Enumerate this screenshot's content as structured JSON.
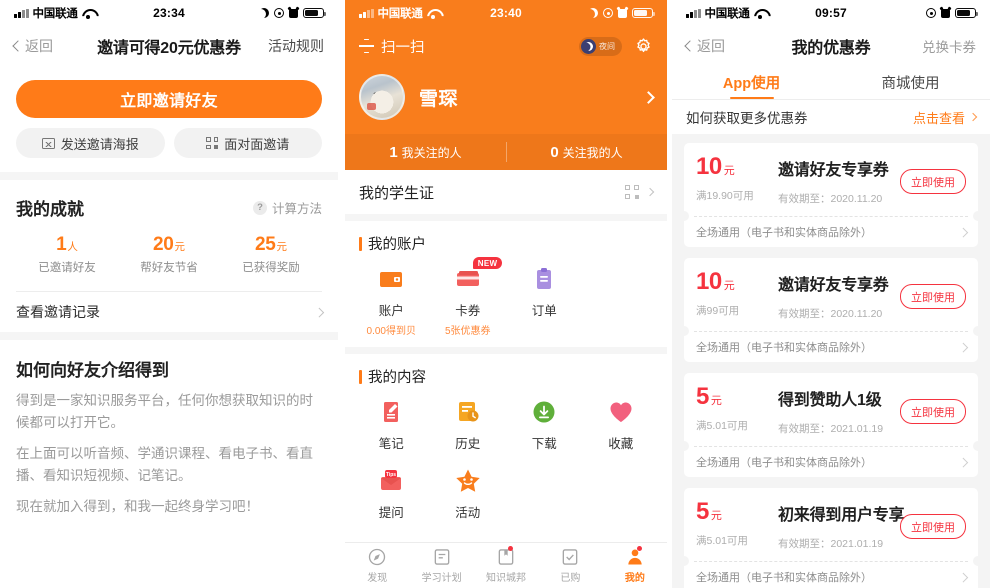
{
  "panel1": {
    "status": {
      "carrier": "中国联通",
      "time": "23:34",
      "icons": [
        "signal-icon",
        "wifi-icon",
        "moon-icon",
        "location-icon",
        "alarm-icon",
        "battery-icon"
      ]
    },
    "nav": {
      "back": "返回",
      "title": "邀请可得20元优惠券",
      "right": "活动规则"
    },
    "cta": "立即邀请好友",
    "sub_buttons": [
      {
        "label": "发送邀请海报",
        "icon": "image-icon"
      },
      {
        "label": "面对面邀请",
        "icon": "qrcode-icon"
      }
    ],
    "achievement": {
      "title": "我的成就",
      "calc_label": "计算方法",
      "help_mark": "?",
      "stats": [
        {
          "num": "1",
          "unit": "人",
          "label": "已邀请好友"
        },
        {
          "num": "20",
          "unit": "元",
          "label": "帮好友节省"
        },
        {
          "num": "25",
          "unit": "元",
          "label": "已获得奖励"
        }
      ],
      "record_link": "查看邀请记录"
    },
    "intro": {
      "title": "如何向好友介绍得到",
      "paragraphs": [
        "得到是一家知识服务平台，任何你想获取知识的时候都可以打开它。",
        "在上面可以听音频、学通识课程、看电子书、看直播、看知识短视频、记笔记。",
        "现在就加入得到，和我一起终身学习吧！"
      ]
    }
  },
  "panel2": {
    "status": {
      "carrier": "中国联通",
      "time": "23:40",
      "icons": [
        "signal-icon",
        "wifi-icon",
        "moon-icon",
        "location-icon",
        "alarm-icon",
        "battery-icon"
      ]
    },
    "nav": {
      "scan": "扫一扫",
      "night_label": "夜间",
      "gear": "settings-icon"
    },
    "profile": {
      "name": "雪琛"
    },
    "follow": [
      {
        "num": "1",
        "text": "我关注的人"
      },
      {
        "num": "0",
        "text": "关注我的人"
      }
    ],
    "student_card": "我的学生证",
    "account_group": {
      "title": "我的账户",
      "items": [
        {
          "label": "账户",
          "sub": "0.00得到贝",
          "icon": "wallet-icon",
          "badge": ""
        },
        {
          "label": "卡券",
          "sub": "5张优惠券",
          "icon": "card-icon",
          "badge": "NEW"
        },
        {
          "label": "订单",
          "sub": "",
          "icon": "clipboard-icon",
          "badge": ""
        }
      ]
    },
    "content_group": {
      "title": "我的内容",
      "items": [
        {
          "label": "笔记",
          "icon": "note-icon"
        },
        {
          "label": "历史",
          "icon": "history-icon"
        },
        {
          "label": "下载",
          "icon": "download-icon"
        },
        {
          "label": "收藏",
          "icon": "heart-icon"
        },
        {
          "label": "提问",
          "icon": "envelope-tips-icon"
        },
        {
          "label": "活动",
          "icon": "star-icon"
        }
      ]
    },
    "tabbar": [
      {
        "label": "发现",
        "icon": "compass-icon",
        "active": false,
        "dot": false
      },
      {
        "label": "学习计划",
        "icon": "list-icon",
        "active": false,
        "dot": false
      },
      {
        "label": "知识城邦",
        "icon": "book-icon",
        "active": false,
        "dot": true
      },
      {
        "label": "已购",
        "icon": "check-doc-icon",
        "active": false,
        "dot": false
      },
      {
        "label": "我的",
        "icon": "person-icon",
        "active": true,
        "dot": true
      }
    ]
  },
  "panel3": {
    "status": {
      "carrier": "中国联通",
      "time": "09:57",
      "icons": [
        "signal-icon",
        "wifi-icon",
        "location-icon",
        "alarm-icon",
        "battery-icon"
      ]
    },
    "nav": {
      "back": "返回",
      "title": "我的优惠券",
      "right": "兑换卡券"
    },
    "tabs": [
      {
        "label": "App使用",
        "active": true
      },
      {
        "label": "商城使用",
        "active": false
      }
    ],
    "more_row": {
      "label": "如何获取更多优惠券",
      "link": "点击查看"
    },
    "coupons": [
      {
        "amount": "10",
        "yuan": "元",
        "name": "邀请好友专享券",
        "condition": "满19.90可用",
        "expiry": "有效期至：2020.11.20",
        "button": "立即使用",
        "scope": "全场通用（电子书和实体商品除外）"
      },
      {
        "amount": "10",
        "yuan": "元",
        "name": "邀请好友专享券",
        "condition": "满99可用",
        "expiry": "有效期至：2020.11.20",
        "button": "立即使用",
        "scope": "全场通用（电子书和实体商品除外）"
      },
      {
        "amount": "5",
        "yuan": "元",
        "name": "得到赞助人1级",
        "condition": "满5.01可用",
        "expiry": "有效期至：2021.01.19",
        "button": "立即使用",
        "scope": "全场通用（电子书和实体商品除外）"
      },
      {
        "amount": "5",
        "yuan": "元",
        "name": "初来得到用户专享",
        "condition": "满5.01可用",
        "expiry": "有效期至：2021.01.19",
        "button": "立即使用",
        "scope": "全场通用（电子书和实体商品除外）"
      }
    ]
  },
  "colors": {
    "brand_orange": "#FF7B18",
    "header_orange": "#F97D1C",
    "coupon_red": "#F5333F",
    "grey_bg": "#f4f4f4"
  }
}
